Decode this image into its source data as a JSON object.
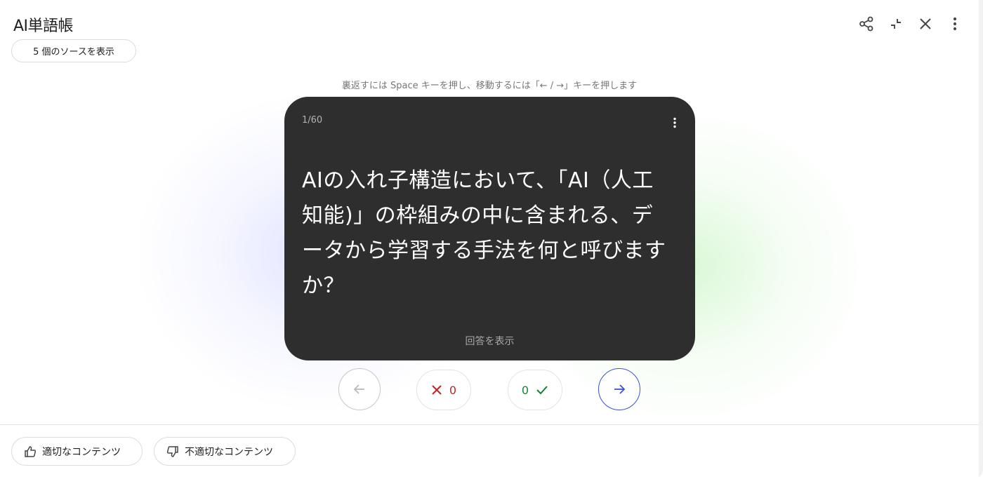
{
  "header": {
    "title": "AI単語帳",
    "sources_label": "5 個のソースを表示",
    "icons": [
      "share-icon",
      "collapse-icon",
      "close-icon",
      "more-vert-icon"
    ]
  },
  "hint": "裏返すには Space キーを押し、移動するには「← / →」キーを押します",
  "card": {
    "counter": "1/60",
    "question": "AIの入れ子構造において、「AI（人工知能)」の枠組みの中に含まれる、データから学習する手法を何と呼びますか？",
    "show_answer": "回答を表示",
    "background": "#2e2e2e"
  },
  "controls": {
    "wrong_count": "0",
    "right_count": "0",
    "next_color": "#3b52d8",
    "wrong_color": "#c5221f",
    "right_color": "#188038"
  },
  "feedback": {
    "good_label": "適切なコンテンツ",
    "bad_label": "不適切なコンテンツ"
  }
}
